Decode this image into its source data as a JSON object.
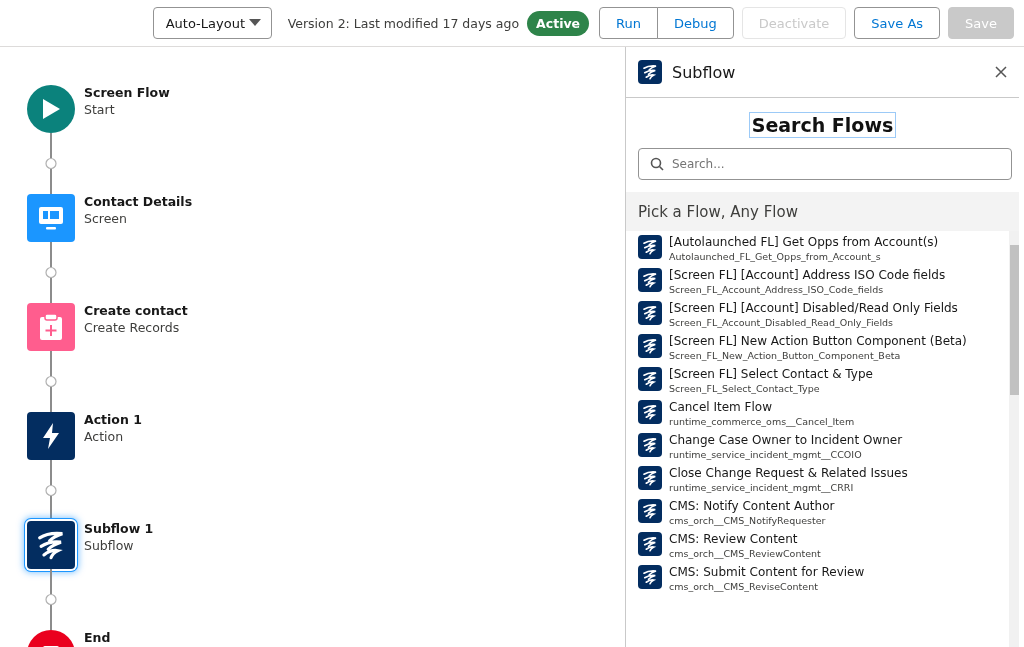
{
  "toolbar": {
    "layout_select": "Auto-Layout",
    "version_text": "Version 2: Last modified 17 days ago",
    "status_badge": "Active",
    "buttons": [
      {
        "label": "Run",
        "disabled": false,
        "group": true
      },
      {
        "label": "Debug",
        "disabled": false,
        "group": true
      },
      {
        "label": "Deactivate",
        "disabled": true,
        "group": false
      },
      {
        "label": "Save As",
        "disabled": false,
        "group": false
      },
      {
        "label": "Save",
        "disabled": true,
        "group": false
      }
    ]
  },
  "flow": {
    "nodes": [
      {
        "kind": "start",
        "title": "Screen Flow",
        "subtitle": "Start",
        "selected": false
      },
      {
        "kind": "screen",
        "title": "Contact Details",
        "subtitle": "Screen",
        "selected": false
      },
      {
        "kind": "create",
        "title": "Create contact",
        "subtitle": "Create Records",
        "selected": false
      },
      {
        "kind": "action",
        "title": "Action 1",
        "subtitle": "Action",
        "selected": false
      },
      {
        "kind": "subflow",
        "title": "Subflow 1",
        "subtitle": "Subflow",
        "selected": true
      },
      {
        "kind": "end",
        "title": "End",
        "selected": false
      }
    ]
  },
  "panel": {
    "title": "Subflow",
    "heading": "Search Flows",
    "search": {
      "placeholder": "Search..."
    },
    "section_title": "Pick a Flow, Any Flow",
    "flows": [
      {
        "label": "[Autolaunched FL] Get Opps from Account(s)",
        "api_name": "Autolaunched_FL_Get_Opps_from_Account_s"
      },
      {
        "label": "[Screen FL] [Account] Address ISO Code fields",
        "api_name": "Screen_FL_Account_Address_ISO_Code_fields"
      },
      {
        "label": "[Screen FL] [Account] Disabled/Read Only Fields",
        "api_name": "Screen_FL_Account_Disabled_Read_Only_Fields"
      },
      {
        "label": "[Screen FL] New Action Button Component (Beta)",
        "api_name": "Screen_FL_New_Action_Button_Component_Beta"
      },
      {
        "label": "[Screen FL] Select Contact & Type",
        "api_name": "Screen_FL_Select_Contact_Type"
      },
      {
        "label": "Cancel Item Flow",
        "api_name": "runtime_commerce_oms__Cancel_Item"
      },
      {
        "label": "Change Case Owner to Incident Owner",
        "api_name": "runtime_service_incident_mgmt__CCOIO"
      },
      {
        "label": "Close Change Request & Related Issues",
        "api_name": "runtime_service_incident_mgmt__CRRI"
      },
      {
        "label": "CMS: Notify Content Author",
        "api_name": "cms_orch__CMS_NotifyRequester"
      },
      {
        "label": "CMS: Review Content",
        "api_name": "cms_orch__CMS_ReviewContent"
      },
      {
        "label": "CMS: Submit Content for Review",
        "api_name": "cms_orch__CMS_ReviseContent"
      }
    ]
  }
}
